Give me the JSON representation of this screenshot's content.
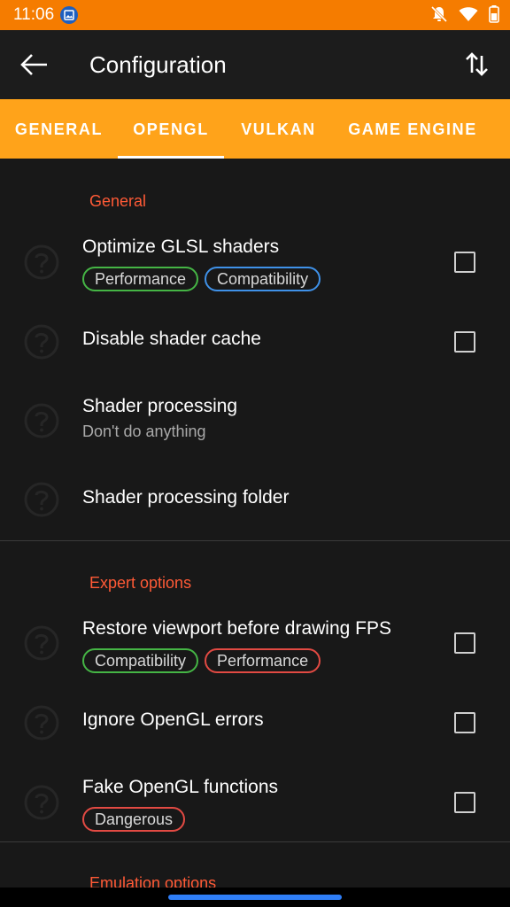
{
  "status_bar": {
    "time": "11:06",
    "icons": [
      "gallery-icon",
      "bell-off-icon",
      "wifi-icon",
      "battery-icon"
    ]
  },
  "app_bar": {
    "title": "Configuration",
    "back_icon": "arrow-left-icon",
    "action_icon": "swap-vertical-icon"
  },
  "tabs": [
    {
      "label": "GENERAL",
      "selected": false
    },
    {
      "label": "OPENGL",
      "selected": true
    },
    {
      "label": "VULKAN",
      "selected": false
    },
    {
      "label": "GAME ENGINE",
      "selected": false
    }
  ],
  "sections": [
    {
      "header": "General",
      "items": [
        {
          "title": "Optimize GLSL shaders",
          "chips": [
            "Performance",
            "Compatibility"
          ],
          "checked": false
        },
        {
          "title": "Disable shader cache",
          "checked": false
        },
        {
          "title": "Shader processing",
          "subtitle": "Don't do anything"
        },
        {
          "title": "Shader processing folder"
        }
      ]
    },
    {
      "header": "Expert options",
      "items": [
        {
          "title": "Restore viewport before drawing FPS",
          "chips": [
            "Compatibility",
            "Performance"
          ],
          "checked": false
        },
        {
          "title": "Ignore OpenGL errors",
          "checked": false
        },
        {
          "title": "Fake OpenGL functions",
          "chips": [
            "Dangerous"
          ],
          "checked": false
        }
      ]
    },
    {
      "header": "Emulation options",
      "items": []
    }
  ],
  "colors": {
    "accent": "#ffa31a",
    "status_bar": "#f57c00",
    "section_header": "#ff5a36",
    "chip_green": "#45b545",
    "chip_blue": "#3f91e8",
    "chip_red": "#e24a43"
  }
}
